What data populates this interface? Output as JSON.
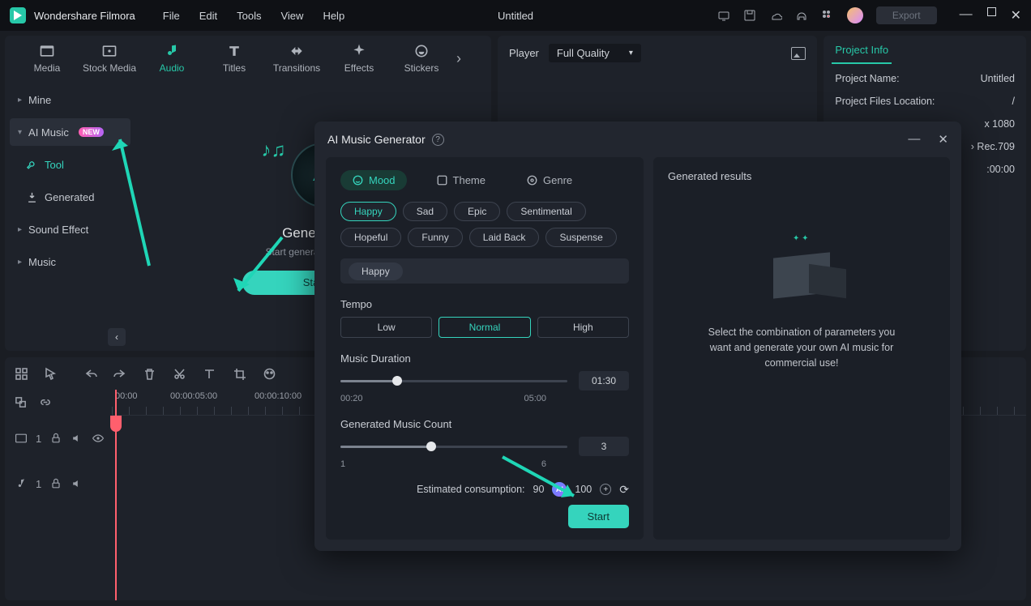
{
  "titlebar": {
    "app": "Wondershare Filmora",
    "menu": [
      "File",
      "Edit",
      "Tools",
      "View",
      "Help"
    ],
    "doc": "Untitled",
    "export": "Export"
  },
  "tabs": {
    "items": [
      {
        "label": "Media"
      },
      {
        "label": "Stock Media"
      },
      {
        "label": "Audio"
      },
      {
        "label": "Titles"
      },
      {
        "label": "Transitions"
      },
      {
        "label": "Effects"
      },
      {
        "label": "Stickers"
      }
    ]
  },
  "sidebar": {
    "mine": "Mine",
    "ai_music": "AI Music",
    "new_badge": "NEW",
    "tool": "Tool",
    "generated": "Generated",
    "sound_effect": "Sound Effect",
    "music": "Music"
  },
  "gen": {
    "title": "Generate",
    "desc": "Start generating your",
    "button": "Sta"
  },
  "player": {
    "label": "Player",
    "quality": "Full Quality"
  },
  "projectinfo": {
    "tab": "Project Info",
    "rows": [
      {
        "k": "Project Name:",
        "v": "Untitled"
      },
      {
        "k": "Project Files Location:",
        "v": "/"
      }
    ],
    "extra": [
      "x 1080",
      "› Rec.709",
      ":00:00"
    ]
  },
  "timeline": {
    "marks": [
      "00:00",
      "00:00:05:00",
      "00:00:10:00"
    ],
    "track1_count": "1",
    "track2_count": "1"
  },
  "modal": {
    "title": "AI Music Generator",
    "cats": [
      "Mood",
      "Theme",
      "Genre"
    ],
    "moods": [
      "Happy",
      "Sad",
      "Epic",
      "Sentimental",
      "Hopeful",
      "Funny",
      "Laid Back",
      "Suspense"
    ],
    "selected_mood": "Happy",
    "tempo_label": "Tempo",
    "tempos": [
      "Low",
      "Normal",
      "High"
    ],
    "duration_label": "Music Duration",
    "duration_min": "00:20",
    "duration_max": "05:00",
    "duration_val": "01:30",
    "count_label": "Generated Music Count",
    "count_min": "1",
    "count_max": "6",
    "count_val": "3",
    "est_label": "Estimated consumption:",
    "est_used": "90",
    "est_total": "100",
    "start": "Start",
    "results_title": "Generated results",
    "results_desc1": "Select the combination of parameters you",
    "results_desc2": "want and generate your own AI music for",
    "results_desc3": "commercial use!"
  }
}
